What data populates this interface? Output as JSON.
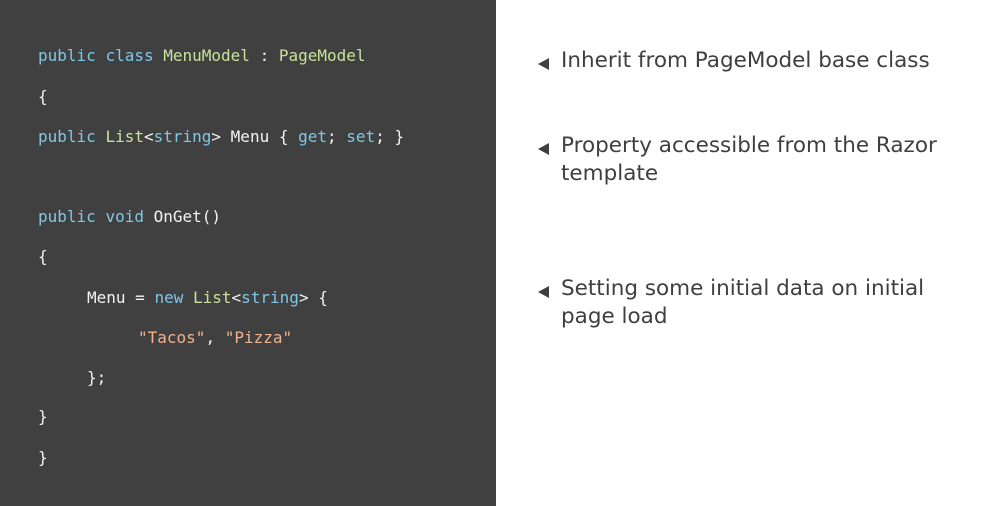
{
  "code": {
    "lines": [
      {
        "tokens": [
          {
            "t": "public ",
            "c": "kw"
          },
          {
            "t": "class ",
            "c": "kw"
          },
          {
            "t": "MenuModel",
            "c": "type"
          },
          {
            "t": " : ",
            "c": "plain"
          },
          {
            "t": "PageModel",
            "c": "type"
          }
        ]
      },
      {
        "tokens": [
          {
            "t": "{",
            "c": "plain"
          }
        ]
      },
      {
        "tokens": [
          {
            "t": "public ",
            "c": "kw"
          },
          {
            "t": "List",
            "c": "type"
          },
          {
            "t": "<",
            "c": "plain"
          },
          {
            "t": "string",
            "c": "kw"
          },
          {
            "t": "> Menu { ",
            "c": "plain"
          },
          {
            "t": "get",
            "c": "kw"
          },
          {
            "t": "; ",
            "c": "plain"
          },
          {
            "t": "set",
            "c": "kw"
          },
          {
            "t": "; }",
            "c": "plain"
          }
        ]
      },
      {
        "tokens": [
          {
            "t": "public ",
            "c": "kw"
          },
          {
            "t": "void ",
            "c": "kw"
          },
          {
            "t": "OnGet()",
            "c": "plain"
          }
        ]
      },
      {
        "tokens": [
          {
            "t": "{",
            "c": "plain"
          }
        ]
      },
      {
        "tokens": [
          {
            "t": "Menu = ",
            "c": "plain"
          },
          {
            "t": "new ",
            "c": "kw"
          },
          {
            "t": "List",
            "c": "type"
          },
          {
            "t": "<",
            "c": "plain"
          },
          {
            "t": "string",
            "c": "kw"
          },
          {
            "t": "> {",
            "c": "plain"
          }
        ]
      },
      {
        "tokens": [
          {
            "t": "\"Tacos\"",
            "c": "str"
          },
          {
            "t": ", ",
            "c": "plain"
          },
          {
            "t": "\"Pizza\"",
            "c": "str"
          }
        ]
      },
      {
        "tokens": [
          {
            "t": "};",
            "c": "plain"
          }
        ]
      },
      {
        "tokens": [
          {
            "t": "}",
            "c": "plain"
          }
        ]
      },
      {
        "tokens": [
          {
            "t": "}",
            "c": "plain"
          }
        ]
      }
    ]
  },
  "notes": [
    {
      "text": "Inherit from PageModel base class"
    },
    {
      "text": "Property accessible from the Razor template"
    },
    {
      "text": "Setting some initial data on initial page load"
    }
  ],
  "colors": {
    "code_background": "#404040",
    "keyword": "#7fc7e8",
    "type": "#c9e29b",
    "string": "#f0b28f",
    "plain": "#f2f2f2",
    "note_text": "#3f3f3f"
  }
}
